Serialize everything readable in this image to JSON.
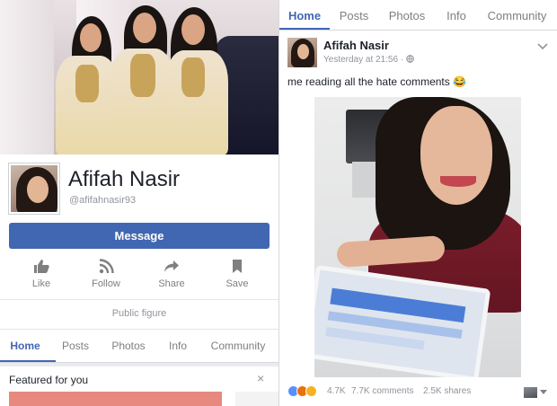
{
  "profile": {
    "name": "Afifah Nasir",
    "handle": "@afifahnasir93",
    "category": "Public figure"
  },
  "cta": {
    "message_label": "Message"
  },
  "actions": [
    {
      "label": "Like",
      "icon": "thumbs-up-icon"
    },
    {
      "label": "Follow",
      "icon": "rss-icon"
    },
    {
      "label": "Share",
      "icon": "share-arrow-icon"
    },
    {
      "label": "Save",
      "icon": "bookmark-icon"
    }
  ],
  "tabs": [
    "Home",
    "Posts",
    "Photos",
    "Info",
    "Community"
  ],
  "active_tab": "Home",
  "featured": {
    "title": "Featured for you",
    "close": "×"
  },
  "post": {
    "author": "Afifah Nasir",
    "time": "Yesterday at 21:56",
    "separator": "·",
    "text": "me reading all the hate comments 😂",
    "reaction_count": "4.7K",
    "comments": "7.7K comments",
    "shares": "2.5K shares"
  },
  "colors": {
    "facebook_blue": "#4267b2",
    "muted_text": "#90949c",
    "reaction_like": "#5890ff",
    "reaction_angry": "#e9710f",
    "reaction_haha": "#f7b125"
  }
}
